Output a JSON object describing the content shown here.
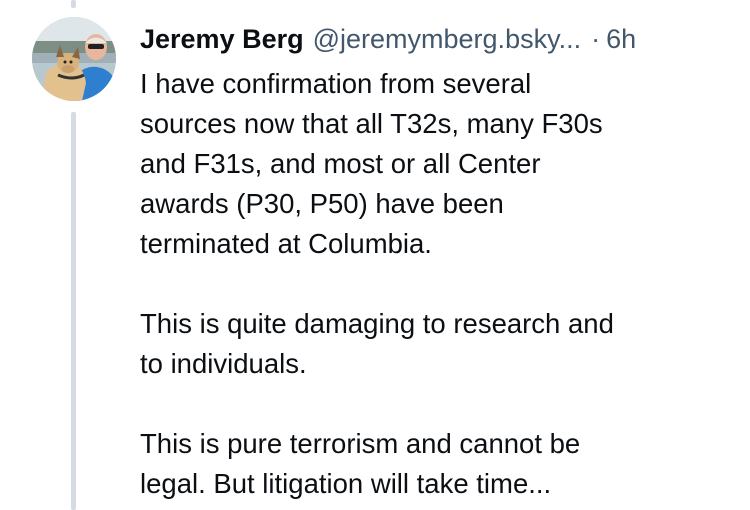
{
  "post": {
    "author": {
      "display_name": "Jeremy Berg",
      "handle": "@jeremymberg.bsky...",
      "avatar": "profile-photo-man-with-dog"
    },
    "separator": "·",
    "timestamp": "6h",
    "paragraphs": [
      {
        "lines": [
          "I have confirmation from several",
          "sources now that all T32s, many F30s",
          "and F31s, and most or all Center",
          "awards (P30, P50) have been",
          "terminated at Columbia."
        ]
      },
      {
        "lines": [
          "This is quite damaging to research and",
          "to individuals."
        ]
      },
      {
        "lines": [
          "This is pure terrorism and cannot be",
          "legal. But litigation will take time..."
        ]
      }
    ]
  },
  "colors": {
    "text": "#0b0f14",
    "secondary": "#42576c",
    "thread_line": "#d4dbe2"
  }
}
